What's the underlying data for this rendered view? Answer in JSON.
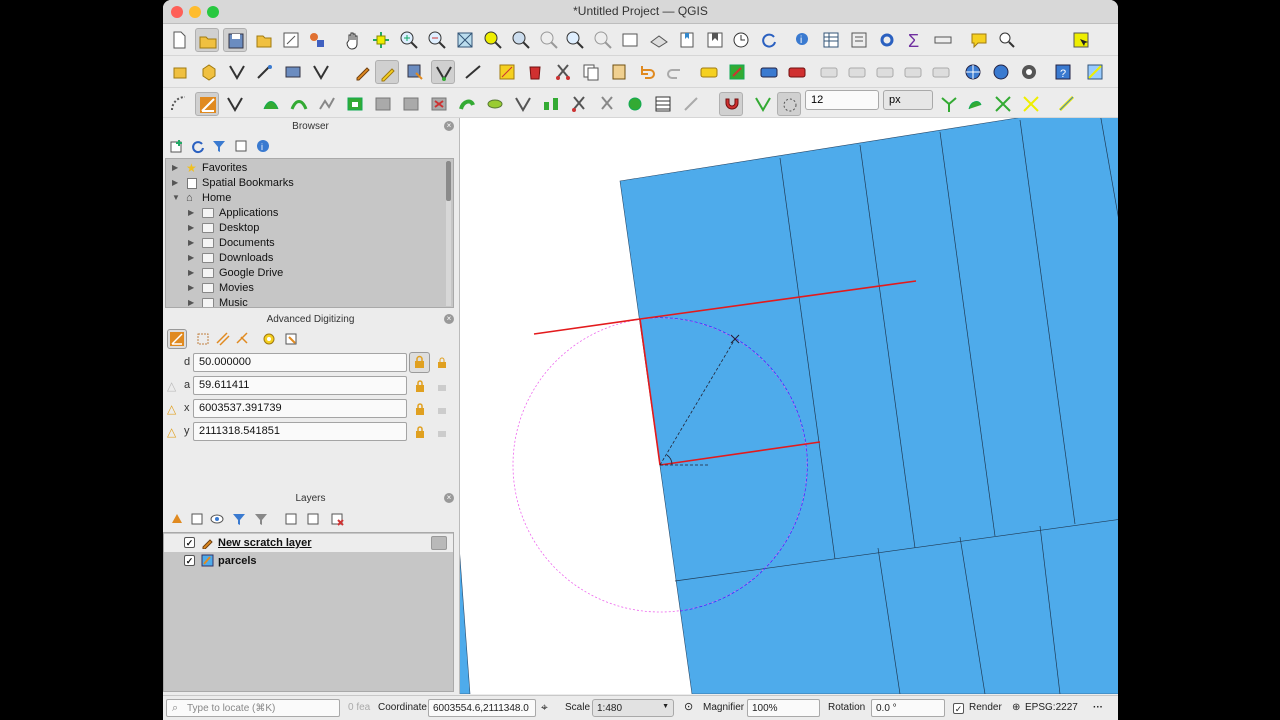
{
  "window": {
    "title": "*Untitled Project — QGIS"
  },
  "snapping": {
    "tolerance": "12",
    "unit": "px"
  },
  "browser": {
    "title": "Browser",
    "items": [
      {
        "label": "Favorites",
        "icon": "star-icon",
        "expanded": false
      },
      {
        "label": "Spatial Bookmarks",
        "icon": "bookmark-icon",
        "expanded": false
      },
      {
        "label": "Home",
        "icon": "home-icon",
        "expanded": true
      },
      {
        "label": "Applications",
        "icon": "folder-icon",
        "child": true
      },
      {
        "label": "Desktop",
        "icon": "folder-icon",
        "child": true
      },
      {
        "label": "Documents",
        "icon": "folder-icon",
        "child": true
      },
      {
        "label": "Downloads",
        "icon": "folder-icon",
        "child": true
      },
      {
        "label": "Google Drive",
        "icon": "drive-icon",
        "child": true
      },
      {
        "label": "Movies",
        "icon": "folder-icon",
        "child": true
      },
      {
        "label": "Music",
        "icon": "folder-icon",
        "child": true
      }
    ]
  },
  "advanced_digitizing": {
    "title": "Advanced Digitizing",
    "fields": [
      {
        "key": "d",
        "value": "50.000000",
        "locked": true
      },
      {
        "key": "a",
        "value": "59.611411",
        "locked": false
      },
      {
        "key": "x",
        "value": "6003537.391739",
        "locked": false
      },
      {
        "key": "y",
        "value": "2111318.541851",
        "locked": false
      }
    ]
  },
  "layers": {
    "title": "Layers",
    "items": [
      {
        "label": "New scratch layer",
        "checked": true,
        "editing": true,
        "selected": true
      },
      {
        "label": "parcels",
        "checked": true,
        "editing": false,
        "selected": false
      }
    ]
  },
  "statusbar": {
    "locate_placeholder": "Type to locate (⌘K)",
    "features": "0 fea",
    "coordinate_label": "Coordinate",
    "coordinate_value": "6003554.6,2111348.0",
    "scale_label": "Scale",
    "scale_value": "1:480",
    "magnifier_label": "Magnifier",
    "magnifier_value": "100%",
    "rotation_label": "Rotation",
    "rotation_value": "0.0 °",
    "render_label": "Render",
    "crs": "EPSG:2227"
  },
  "colors": {
    "parcel_fill": "#4eabeb",
    "digitize_line": "#e31a1c",
    "snap_circle": "#3333ff",
    "guide_circle": "#ee66ee"
  }
}
